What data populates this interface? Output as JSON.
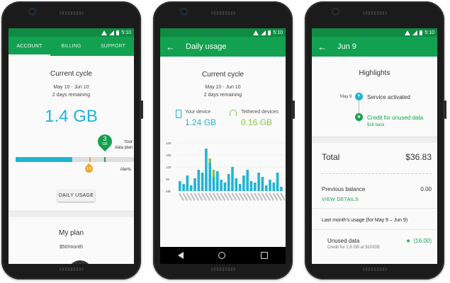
{
  "status": {
    "time": "5:10"
  },
  "phone1": {
    "tabs": [
      {
        "label": "ACCOUNT",
        "active": true
      },
      {
        "label": "BILLING",
        "active": false
      },
      {
        "label": "SUPPORT",
        "active": false
      }
    ],
    "cycle_title": "Current cycle",
    "cycle_dates": "May 10 - Jun 10",
    "days_remaining": "2 days remaining",
    "usage_total": "1.4 GB",
    "plan_marker_value": "3",
    "plan_marker_unit": "GB",
    "plan_marker_label_1": "Your",
    "plan_marker_label_2": "data plan",
    "alert_marker_value": "2.5",
    "alerts_label": "Alerts",
    "usage_fraction": 0.47,
    "daily_usage_button": "DAILY USAGE",
    "plan_title": "My plan",
    "plan_price": "$50/month"
  },
  "phone2": {
    "title": "Daily usage",
    "cycle_title": "Current cycle",
    "cycle_dates": "May 10 - Jun 10",
    "days_remaining": "2 days remaining",
    "device_label": "Your device",
    "device_value": "1.24 GB",
    "tethered_label": "Tethered devices",
    "tethered_value": "0.16 GB",
    "chart_yticks": [
      "240",
      "180",
      "120",
      "60",
      "MB"
    ]
  },
  "phone3": {
    "title": "Jun 9",
    "highlights_title": "Highlights",
    "event1_date": "May 9",
    "event1_text": "Service activated",
    "event2_text": "Credit for unused data",
    "event2_sub": "$16 back",
    "total_label": "Total",
    "total_value": "$36.83",
    "prev_balance_label": "Previous balance",
    "prev_balance_value": "0.00",
    "view_details": "VIEW DETAILS",
    "last_month_title": "Last month's usage (for May 9 – Jun 9)",
    "unused_data_label": "Unused data",
    "unused_data_value": "(16.00)",
    "credit_note": "Credit for 1.6 GB at $10/GB"
  },
  "colors": {
    "primary": "#12a150",
    "statusbar": "#0f8a43",
    "accent_blue": "#1fb5d4",
    "accent_orange": "#f2a32d",
    "accent_green": "#8bc34a"
  }
}
